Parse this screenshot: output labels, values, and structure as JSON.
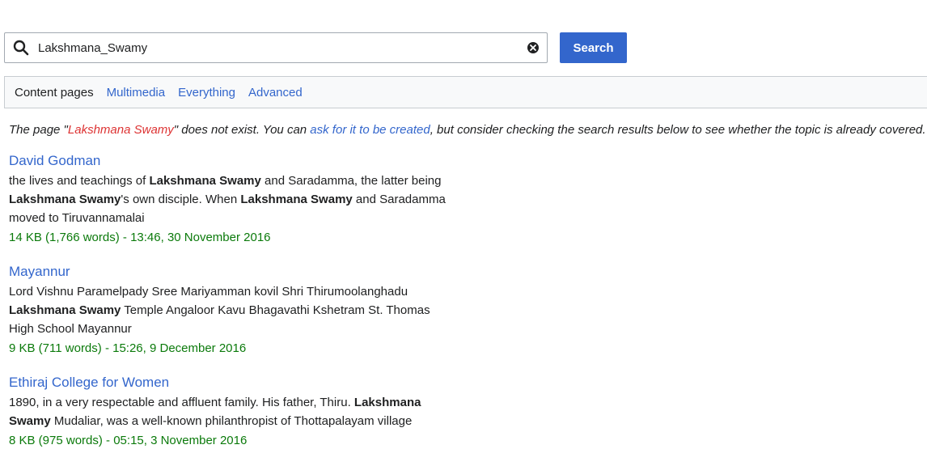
{
  "search": {
    "value": "Lakshmana_Swamy",
    "button_label": "Search"
  },
  "profiles": [
    {
      "label": "Content pages",
      "active": true
    },
    {
      "label": "Multimedia",
      "active": false
    },
    {
      "label": "Everything",
      "active": false
    },
    {
      "label": "Advanced",
      "active": false
    }
  ],
  "notice": {
    "prefix": "The page \"",
    "page_name": "Lakshmana Swamy",
    "middle": "\" does not exist. You can ",
    "link_text": "ask for it to be created",
    "suffix": ", but consider checking the search results below to see whether the topic is already covered."
  },
  "results": [
    {
      "title": "David Godman",
      "snippet": [
        [
          "the lives and teachings of ",
          false
        ],
        [
          "Lakshmana Swamy",
          true
        ],
        [
          " and Saradamma, the latter being",
          false
        ],
        [
          "\n",
          false
        ],
        [
          "Lakshmana Swamy",
          true
        ],
        [
          "'s own disciple. When ",
          false
        ],
        [
          "Lakshmana Swamy",
          true
        ],
        [
          " and Saradamma",
          false
        ],
        [
          "\n",
          false
        ],
        [
          "moved to Tiruvannamalai",
          false
        ]
      ],
      "meta": "14 KB (1,766 words) - 13:46, 30 November 2016"
    },
    {
      "title": "Mayannur",
      "snippet": [
        [
          "Lord Vishnu Paramelpady Sree Mariyamman kovil Shri Thirumoolanghadu",
          false
        ],
        [
          "\n",
          false
        ],
        [
          "Lakshmana Swamy",
          true
        ],
        [
          " Temple Angaloor Kavu Bhagavathi Kshetram St. Thomas",
          false
        ],
        [
          "\n",
          false
        ],
        [
          "High School Mayannur",
          false
        ]
      ],
      "meta": "9 KB (711 words) - 15:26, 9 December 2016"
    },
    {
      "title": "Ethiraj College for Women",
      "snippet": [
        [
          "1890, in a very respectable and affluent family. His father, Thiru. ",
          false
        ],
        [
          "Lakshmana",
          true
        ],
        [
          "\n",
          false
        ],
        [
          "Swamy",
          true
        ],
        [
          " Mudaliar, was a well-known philanthropist of Thottapalayam village",
          false
        ]
      ],
      "meta": "8 KB (975 words) - 05:15, 3 November 2016"
    }
  ],
  "icons": {
    "search": "search-icon",
    "clear": "clear-icon"
  },
  "colors": {
    "accent": "#3366cc",
    "redlink": "#dd3333",
    "meta_green": "#0b7a0b"
  }
}
